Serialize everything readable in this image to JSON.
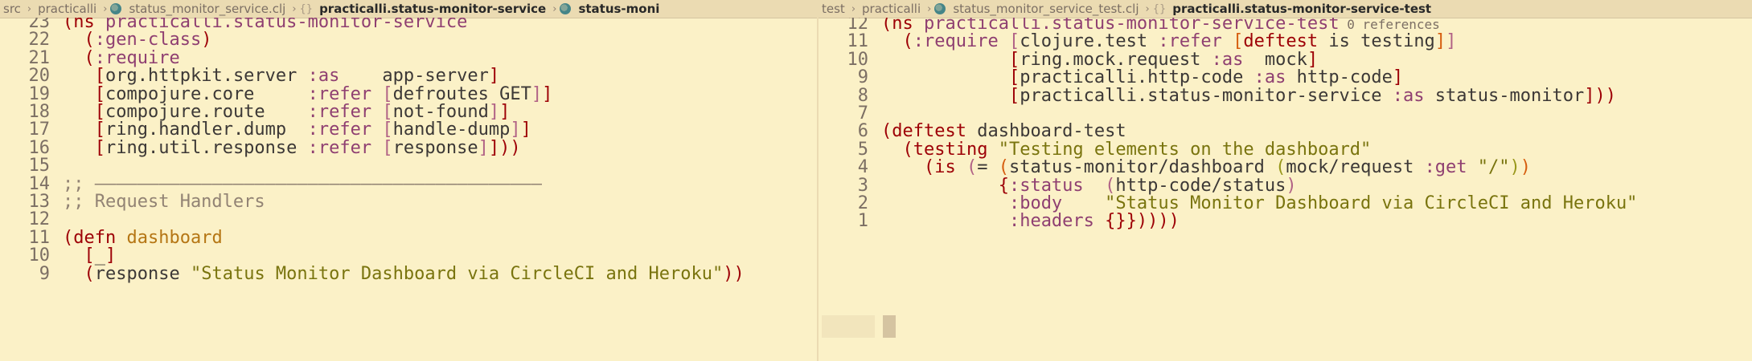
{
  "breadcrumb_left": [
    "src",
    "practicalli",
    "status_monitor_service.clj",
    "practicalli.status-monitor-service",
    "status-moni"
  ],
  "breadcrumb_right": [
    "test",
    "practicalli",
    "status_monitor_service_test.clj",
    "practicalli.status-monitor-service-test"
  ],
  "left": {
    "lines": [
      {
        "n": "23",
        "t": "(ns practicalli.status-monitor-service"
      },
      {
        "n": "22",
        "t": "  (:gen-class)"
      },
      {
        "n": "21",
        "t": "  (:require"
      },
      {
        "n": "20",
        "t": "   [org.httpkit.server :as    app-server]"
      },
      {
        "n": "19",
        "t": "   [compojure.core     :refer [defroutes GET]]"
      },
      {
        "n": "18",
        "t": "   [compojure.route    :refer [not-found]]"
      },
      {
        "n": "17",
        "t": "   [ring.handler.dump  :refer [handle-dump]]"
      },
      {
        "n": "16",
        "t": "   [ring.util.response :refer [response]]))"
      },
      {
        "n": "15",
        "t": ""
      },
      {
        "n": "14",
        "t": ";; ——————————————————————————————————————————"
      },
      {
        "n": "13",
        "t": ";; Request Handlers"
      },
      {
        "n": "12",
        "t": ""
      },
      {
        "n": "11",
        "t": "(defn dashboard"
      },
      {
        "n": "10",
        "t": "  [_]"
      },
      {
        "n": "9",
        "t": "  (response \"Status Monitor Dashboard via CircleCI and Heroku\"))"
      }
    ]
  },
  "right": {
    "references": "0 references",
    "lines": [
      {
        "n": "12",
        "t": "(ns practicalli.status-monitor-service-test"
      },
      {
        "n": "11",
        "t": "  (:require [clojure.test :refer [deftest is testing]]"
      },
      {
        "n": "10",
        "t": "            [ring.mock.request :as  mock]"
      },
      {
        "n": "9",
        "t": "            [practicalli.http-code :as http-code]"
      },
      {
        "n": "8",
        "t": "            [practicalli.status-monitor-service :as status-monitor]))"
      },
      {
        "n": "7",
        "t": ""
      },
      {
        "n": "6",
        "t": "(deftest dashboard-test"
      },
      {
        "n": "5",
        "t": "  (testing \"Testing elements on the dashboard\""
      },
      {
        "n": "4",
        "t": "    (is (= (status-monitor/dashboard (mock/request :get \"/\"))"
      },
      {
        "n": "3",
        "t": "           {:status  (http-code/status)"
      },
      {
        "n": "2",
        "t": "            :body    \"Status Monitor Dashboard via CircleCI and Heroku\""
      },
      {
        "n": "1",
        "t": "            :headers {}}))))"
      }
    ]
  }
}
